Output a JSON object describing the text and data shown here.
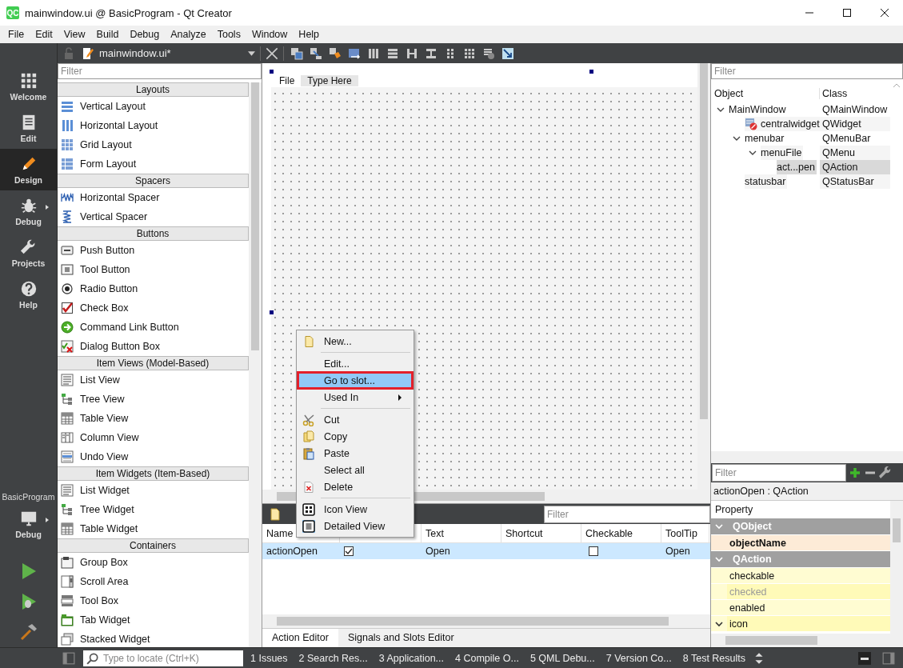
{
  "window": {
    "logo": "QC",
    "title": "mainwindow.ui @ BasicProgram - Qt Creator"
  },
  "menu_bar": [
    "File",
    "Edit",
    "View",
    "Build",
    "Debug",
    "Analyze",
    "Tools",
    "Window",
    "Help"
  ],
  "modes": [
    {
      "label": "Welcome",
      "kind": "welcome",
      "selected": false,
      "has_menu": false
    },
    {
      "label": "Edit",
      "kind": "edit",
      "selected": false,
      "has_menu": false
    },
    {
      "label": "Design",
      "kind": "design",
      "selected": true,
      "has_menu": false
    },
    {
      "label": "Debug",
      "kind": "debug",
      "selected": false,
      "has_menu": true
    },
    {
      "label": "Projects",
      "kind": "projects",
      "selected": false,
      "has_menu": false
    },
    {
      "label": "Help",
      "kind": "help",
      "selected": false,
      "has_menu": false
    }
  ],
  "target": {
    "project": "BasicProgram",
    "build": "Debug"
  },
  "document": {
    "name": "mainwindow.ui*"
  },
  "widget_box": {
    "placeholder": "Filter",
    "categories": [
      {
        "title": "Layouts",
        "items": [
          {
            "label": "Vertical Layout",
            "kind": "vlayout"
          },
          {
            "label": "Horizontal Layout",
            "kind": "hlayout"
          },
          {
            "label": "Grid Layout",
            "kind": "grid"
          },
          {
            "label": "Form Layout",
            "kind": "form"
          }
        ]
      },
      {
        "title": "Spacers",
        "items": [
          {
            "label": "Horizontal Spacer",
            "kind": "hspacer"
          },
          {
            "label": "Vertical Spacer",
            "kind": "vspacer"
          }
        ]
      },
      {
        "title": "Buttons",
        "items": [
          {
            "label": "Push Button",
            "kind": "push"
          },
          {
            "label": "Tool Button",
            "kind": "tool"
          },
          {
            "label": "Radio Button",
            "kind": "radio"
          },
          {
            "label": "Check Box",
            "kind": "check"
          },
          {
            "label": "Command Link Button",
            "kind": "command"
          },
          {
            "label": "Dialog Button Box",
            "kind": "dialog"
          }
        ]
      },
      {
        "title": "Item Views (Model-Based)",
        "items": [
          {
            "label": "List View",
            "kind": "list"
          },
          {
            "label": "Tree View",
            "kind": "tree"
          },
          {
            "label": "Table View",
            "kind": "table"
          },
          {
            "label": "Column View",
            "kind": "column"
          },
          {
            "label": "Undo View",
            "kind": "undo"
          }
        ]
      },
      {
        "title": "Item Widgets (Item-Based)",
        "items": [
          {
            "label": "List Widget",
            "kind": "list"
          },
          {
            "label": "Tree Widget",
            "kind": "tree"
          },
          {
            "label": "Table Widget",
            "kind": "table"
          }
        ]
      },
      {
        "title": "Containers",
        "items": [
          {
            "label": "Group Box",
            "kind": "group"
          },
          {
            "label": "Scroll Area",
            "kind": "scroll"
          },
          {
            "label": "Tool Box",
            "kind": "toolbox"
          },
          {
            "label": "Tab Widget",
            "kind": "tab"
          },
          {
            "label": "Stacked Widget",
            "kind": "stacked"
          }
        ]
      }
    ]
  },
  "form": {
    "menus": [
      {
        "label": "File",
        "kind": "menu"
      },
      {
        "label": "Type Here",
        "kind": "type_here"
      }
    ]
  },
  "context_menu": [
    {
      "kind": "new",
      "label": "New...",
      "selected": false,
      "outlined": false
    },
    {
      "kind": "separator"
    },
    {
      "kind": "plain",
      "label": "Edit...",
      "selected": false,
      "outlined": false
    },
    {
      "kind": "plain",
      "label": "Go to slot...",
      "selected": true,
      "outlined": true
    },
    {
      "kind": "submenu",
      "label": "Used In",
      "selected": false,
      "outlined": false
    },
    {
      "kind": "separator"
    },
    {
      "kind": "cut",
      "label": "Cut",
      "selected": false,
      "outlined": false
    },
    {
      "kind": "copy",
      "label": "Copy",
      "selected": false,
      "outlined": false
    },
    {
      "kind": "paste",
      "label": "Paste",
      "selected": false,
      "outlined": false
    },
    {
      "kind": "plain",
      "label": "Select all",
      "selected": false,
      "outlined": false
    },
    {
      "kind": "delete",
      "label": "Delete",
      "selected": false,
      "outlined": false
    },
    {
      "kind": "separator"
    },
    {
      "kind": "iconview",
      "label": "Icon View",
      "selected": false,
      "outlined": false
    },
    {
      "kind": "detailview",
      "label": "Detailed View",
      "selected": true,
      "outlined": false
    }
  ],
  "action_editor": {
    "placeholder": "Filter",
    "headers": [
      "Name",
      "Text",
      "Shortcut",
      "Checkable",
      "ToolTip"
    ],
    "rows": [
      {
        "name": "actionOpen",
        "used": true,
        "text": "Open",
        "checkable": false,
        "tooltip": "Open",
        "selected": true
      }
    ],
    "tabs": [
      {
        "label": "Action Editor",
        "selected": true
      },
      {
        "label": "Signals and Slots Editor",
        "selected": false
      }
    ]
  },
  "object_inspector": {
    "placeholder": "Filter",
    "columns": [
      "Object",
      "Class"
    ],
    "tree": [
      {
        "object": "MainWindow",
        "class": "QMainWindow",
        "selected": false,
        "expanded": true,
        "children": [
          {
            "object": "centralwidget",
            "class": "QWidget",
            "selected": false,
            "kind": "widget"
          },
          {
            "object": "menubar",
            "class": "QMenuBar",
            "selected": false,
            "expanded": true,
            "children": [
              {
                "object": "menuFile",
                "class": "QMenu",
                "selected": false,
                "expanded": true,
                "children": [
                  {
                    "object": "act...pen",
                    "class": "QAction",
                    "selected": true
                  }
                ]
              }
            ]
          },
          {
            "object": "statusbar",
            "class": "QStatusBar",
            "selected": false
          }
        ]
      }
    ]
  },
  "property_editor": {
    "placeholder": "Filter",
    "object": "actionOpen : QAction",
    "header": "Property",
    "groups": [
      {
        "name": "QObject",
        "color": "#fdebd7",
        "expanded": true,
        "properties": [
          {
            "name": "objectName",
            "changed": true,
            "disabled": false
          }
        ]
      },
      {
        "name": "QAction",
        "color": "#fffcd2",
        "expanded": true,
        "properties": [
          {
            "name": "checkable",
            "changed": false,
            "disabled": false
          },
          {
            "name": "checked",
            "changed": false,
            "disabled": true
          },
          {
            "name": "enabled",
            "changed": false,
            "disabled": false
          },
          {
            "name": "icon",
            "changed": false,
            "disabled": false,
            "expanded": true
          }
        ]
      }
    ]
  },
  "status_bar": {
    "placeholder": "Type to locate (Ctrl+K)",
    "panes": [
      "1 Issues",
      "2 Search Res...",
      "3 Application...",
      "4 Compile O...",
      "5 QML Debu...",
      "7 Version Co...",
      "8 Test Results"
    ]
  }
}
